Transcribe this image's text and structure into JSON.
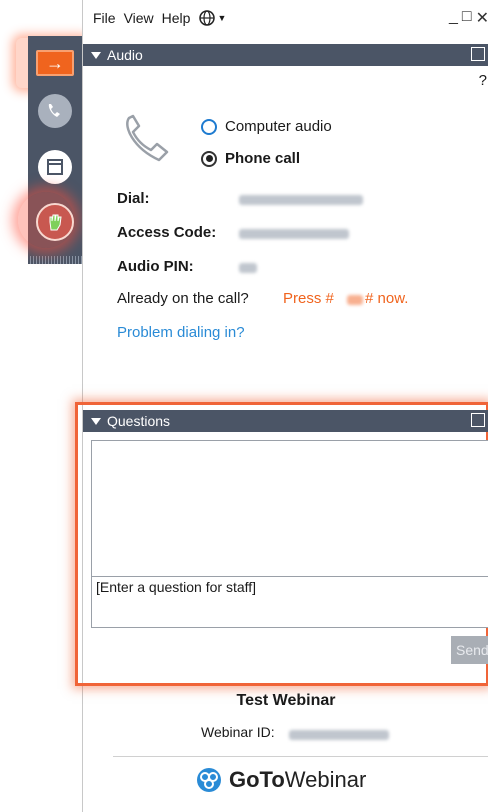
{
  "menu": {
    "file": "File",
    "view": "View",
    "help": "Help",
    "language_icon": "globe-icon"
  },
  "window_controls": [
    "minimize-icon",
    "restore-icon",
    "close-icon"
  ],
  "audio": {
    "header": "Audio",
    "help_mark": "?",
    "options": [
      {
        "label": "Computer audio",
        "selected": false
      },
      {
        "label": "Phone call",
        "selected": true
      }
    ],
    "dial_label": "Dial:",
    "access_code_label": "Access Code:",
    "audio_pin_label": "Audio PIN:",
    "already_text": "Already on the call?",
    "press_prefix": "Press #",
    "press_suffix": "# now.",
    "problem_link": "Problem dialing in?"
  },
  "questions": {
    "header": "Questions",
    "input_placeholder": "[Enter a question for staff]",
    "send_label": "Send"
  },
  "footer": {
    "webinar_title": "Test Webinar",
    "webinar_id_label": "Webinar ID:",
    "brand_bold": "GoTo",
    "brand_light": "Webinar"
  },
  "colors": {
    "accent": "#f0641e",
    "header_bg": "#4b5566",
    "link": "#2a8bd6"
  }
}
